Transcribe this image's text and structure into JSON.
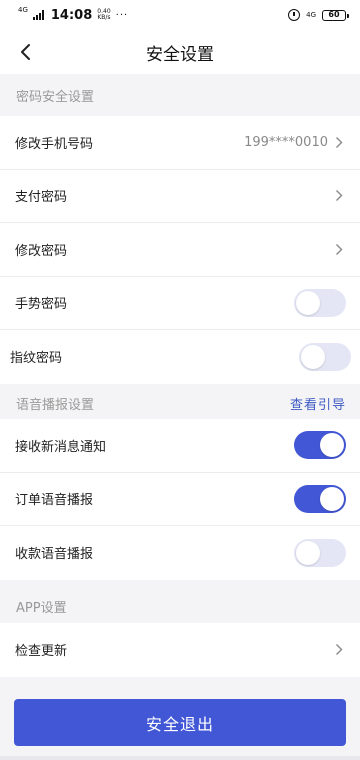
{
  "status_bar": {
    "net_left": "4G",
    "time": "14:08",
    "speed_value": "0.40",
    "speed_unit": "KB/s",
    "dots": "···",
    "net_right": "4G",
    "battery": "60"
  },
  "nav": {
    "title": "安全设置"
  },
  "sections": {
    "password": {
      "title": "密码安全设置"
    },
    "voice": {
      "title": "语音播报设置",
      "link": "查看引导"
    },
    "app": {
      "title": "APP设置"
    }
  },
  "password_rows": [
    {
      "label": "修改手机号码",
      "value": "199****0010"
    },
    {
      "label": "支付密码"
    },
    {
      "label": "修改密码"
    },
    {
      "label": "手势密码",
      "toggle_on": false
    },
    {
      "label": "指纹密码",
      "toggle_on": false
    }
  ],
  "voice_rows": [
    {
      "label": "接收新消息通知",
      "toggle_on": true
    },
    {
      "label": "订单语音播报",
      "toggle_on": true
    },
    {
      "label": "收款语音播报",
      "toggle_on": false
    }
  ],
  "app_rows": [
    {
      "label": "检查更新"
    }
  ],
  "logout_button": "安全退出",
  "colors": {
    "accent": "#4257d6",
    "toggle_off": "#e4e6f6",
    "link": "#3d59c4",
    "page_bg": "#f4f4f6"
  }
}
